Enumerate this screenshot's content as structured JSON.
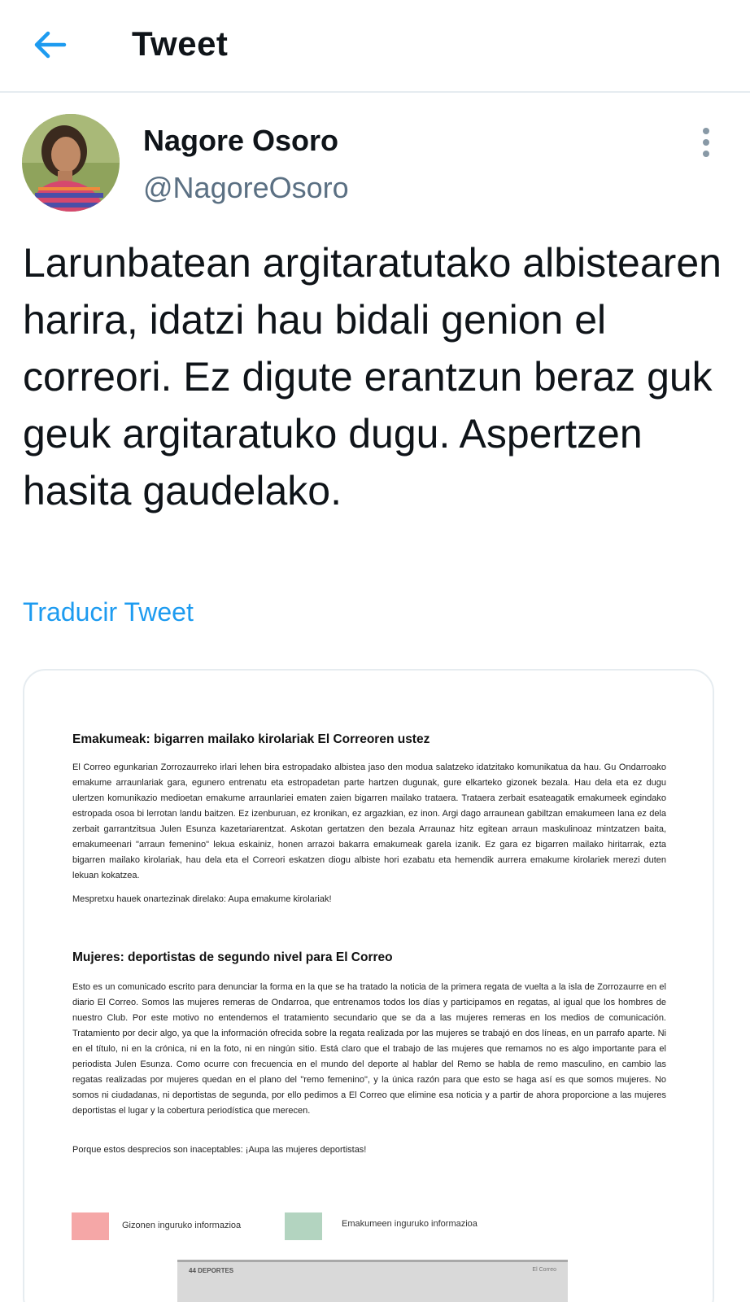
{
  "topbar": {
    "title": "Tweet",
    "back_icon": "arrow-left-icon"
  },
  "colors": {
    "accent": "#1d9bf0",
    "secondary_text": "#5b7083",
    "divider": "#e6ecf0",
    "men_swatch": "#f5a7a7",
    "women_swatch": "#b3d4c0"
  },
  "author": {
    "name": "Nagore Osoro",
    "handle": "@NagoreOsoro",
    "more_icon": "more-vertical-icon"
  },
  "tweet": {
    "text": "Larunbatean argitaratutako albistearen harira, idatzi hau bidali genion el correori. Ez digute erantzun beraz guk geuk argitaratuko dugu. Aspertzen hasita gaudelako.",
    "translate_label": "Traducir Tweet"
  },
  "media": {
    "section_eu": {
      "title": "Emakumeak: bigarren mailako kirolariak El Correoren ustez",
      "body": "El Correo egunkarian Zorrozaurreko irlari lehen bira estropadako albistea jaso den modua salatzeko idatzitako komunikatua da hau. Gu Ondarroako emakume arraunlariak gara, egunero entrenatu eta estropadetan parte hartzen dugunak, gure elkarteko gizonek bezala. Hau dela eta ez dugu ulertzen komunikazio medioetan emakume arraunlariei ematen zaien bigarren mailako trataera. Trataera zerbait esateagatik emakumeek egindako estropada osoa bi lerrotan landu baitzen. Ez izenburuan, ez kronikan, ez argazkian, ez inon. Argi dago arraunean gabiltzan emakumeen lana ez dela zerbait garrantzitsua Julen Esunza kazetariarentzat. Askotan gertatzen den bezala Arraunaz hitz egitean arraun maskulinoaz mintzatzen baita, emakumeenari \"arraun femenino\" lekua eskainiz, honen arrazoi bakarra emakumeak garela izanik. Ez gara ez bigarren mailako hiritarrak, ezta bigarren mailako kirolariak, hau dela eta el Correori eskatzen diogu albiste hori ezabatu eta hemendik aurrera emakume kirolariek merezi duten lekuan kokatzea.",
      "closing": "Mespretxu hauek onartezinak direlako: Aupa emakume kirolariak!"
    },
    "section_es": {
      "title": "Mujeres: deportistas de segundo nivel para El Correo",
      "body": "Esto es un comunicado escrito para denunciar la forma en la que se ha tratado la noticia de la primera regata de vuelta a la isla de Zorrozaurre en el diario El Correo. Somos las mujeres remeras de Ondarroa, que entrenamos todos los días y participamos en regatas, al igual que los hombres de nuestro Club. Por este motivo no entendemos el tratamiento secundario que se da a las mujeres remeras en los medios de comunicación. Tratamiento por decir algo, ya que la información ofrecida sobre la regata realizada por las mujeres se trabajó en dos líneas, en un parrafo aparte. Ni en el título, ni en la crónica, ni en la foto, ni en ningún sitio. Está claro que el trabajo de las mujeres que remamos no es algo importante para el periodista Julen Esunza. Como ocurre con frecuencia en el mundo del deporte al hablar del Remo se habla de remo masculino, en cambio las regatas realizadas por mujeres quedan en el plano del \"remo femenino\", y la única razón para que esto se haga así es que somos mujeres. No somos ni ciudadanas, ni deportistas de segunda, por ello pedimos a El Correo que elimine esa noticia y a partir de ahora proporcione a las mujeres deportistas el lugar y la cobertura periodística que merecen.",
      "closing": "Porque estos desprecios son inaceptables: ¡Aupa las mujeres deportistas!"
    },
    "legend": {
      "men_label": "Gizonen inguruko informazioa",
      "women_label": "Emakumeen inguruko informazioa"
    },
    "clipping": {
      "left_text": "44 DEPORTES",
      "right_text": "El Correo"
    }
  }
}
